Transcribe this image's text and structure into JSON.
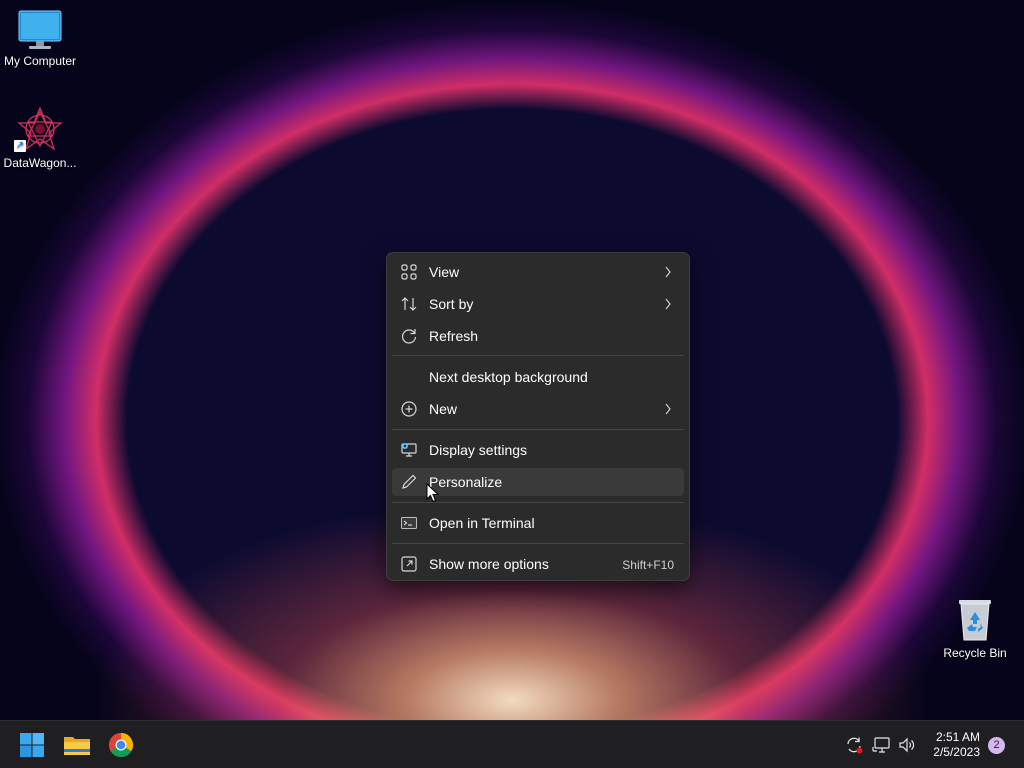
{
  "desktop": {
    "icons": [
      {
        "label": "My Computer",
        "icon": "monitor-icon"
      },
      {
        "label": "DataWagon...",
        "icon": "datawagon-logo-icon"
      },
      {
        "label": "Recycle Bin",
        "icon": "recycle-bin-icon"
      }
    ]
  },
  "context_menu": {
    "items": [
      {
        "label": "View",
        "icon": "grid-view-icon",
        "submenu": true
      },
      {
        "label": "Sort by",
        "icon": "sort-arrows-icon",
        "submenu": true
      },
      {
        "label": "Refresh",
        "icon": "refresh-icon",
        "submenu": false
      },
      {
        "label": "Next desktop background",
        "icon": "",
        "submenu": false
      },
      {
        "label": "New",
        "icon": "plus-circle-icon",
        "submenu": true
      },
      {
        "label": "Display settings",
        "icon": "display-settings-icon",
        "submenu": false
      },
      {
        "label": "Personalize",
        "icon": "pen-icon",
        "submenu": false,
        "hovered": true
      },
      {
        "label": "Open in Terminal",
        "icon": "terminal-icon",
        "submenu": false
      },
      {
        "label": "Show more options",
        "icon": "show-more-icon",
        "shortcut": "Shift+F10"
      }
    ]
  },
  "taskbar": {
    "apps": [
      {
        "name": "start",
        "icon": "windows-start-icon"
      },
      {
        "name": "file-explorer",
        "icon": "folder-icon"
      },
      {
        "name": "chrome",
        "icon": "chrome-icon"
      }
    ],
    "tray": {
      "icons": [
        "sync-icon",
        "network-icon",
        "volume-icon"
      ],
      "time": "2:51 AM",
      "date": "2/5/2023",
      "notification_count": "2"
    }
  },
  "colors": {
    "menu_bg": "#2b2b2b",
    "menu_hover": "#3a3a3a",
    "taskbar_bg": "#1f1f22",
    "accent_blue": "#4cc2ff"
  }
}
